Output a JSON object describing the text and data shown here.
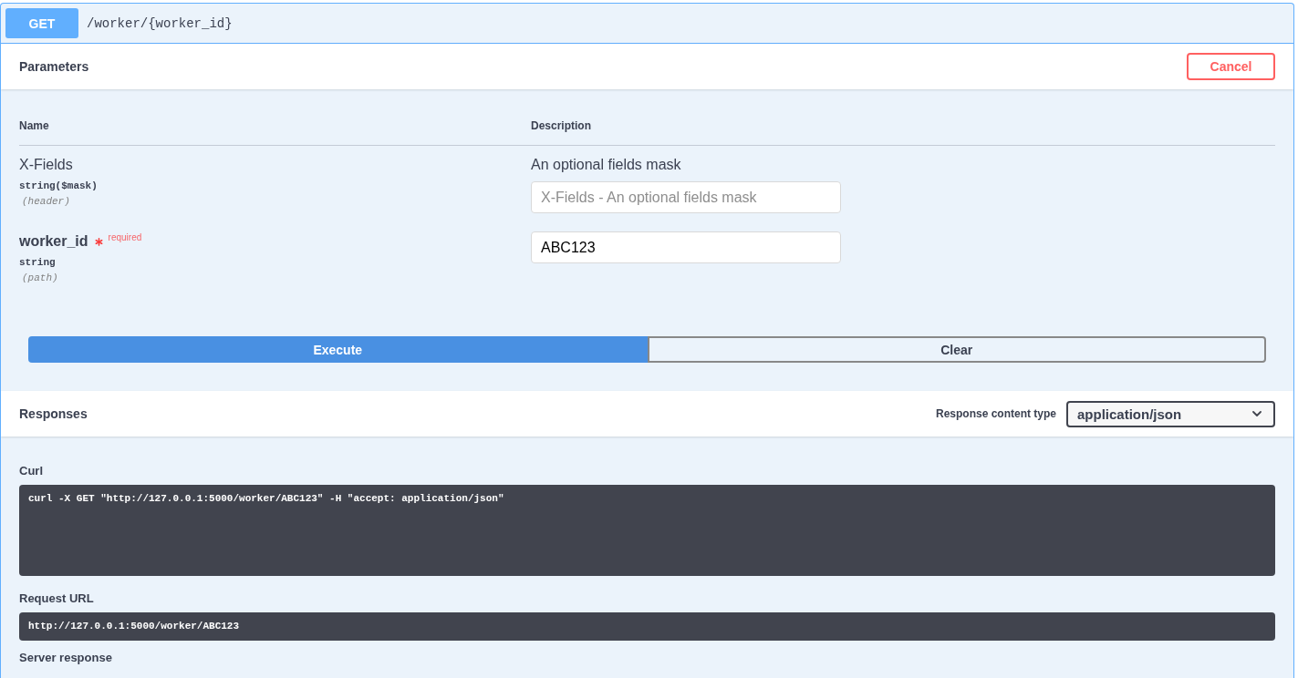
{
  "operation": {
    "method": "GET",
    "path": "/worker/{worker_id}"
  },
  "parameters": {
    "title": "Parameters",
    "cancel_button": "Cancel",
    "columns": [
      "Name",
      "Description"
    ],
    "rows": [
      {
        "name": "X-Fields",
        "required": false,
        "type": "string($mask)",
        "location": "(header)",
        "description": "An optional fields mask",
        "placeholder": "X-Fields - An optional fields mask"
      },
      {
        "name": "worker_id",
        "required": true,
        "required_label": "required",
        "type": "string",
        "location": "(path)",
        "value": "ABC123"
      }
    ]
  },
  "actions": [
    {
      "label": "Execute",
      "kind": "primary"
    },
    {
      "label": "Clear",
      "kind": "secondary"
    }
  ],
  "responses": {
    "title": "Responses",
    "content_type_label": "Response content type",
    "content_type": "application/json",
    "curl_label": "Curl",
    "curl": "curl -X GET \"http://127.0.0.1:5000/worker/ABC123\" -H \"accept: application/json\"",
    "request_url_label": "Request URL",
    "request_url": "http://127.0.0.1:5000/worker/ABC123",
    "server_response_label": "Server response"
  }
}
